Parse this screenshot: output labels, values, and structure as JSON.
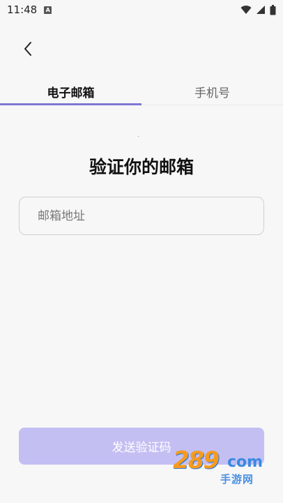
{
  "status_bar": {
    "time": "11:48",
    "notification_icon": "a-icon",
    "wifi_icon": "wifi-icon",
    "signal_icon": "signal-icon",
    "battery_icon": "battery-icon"
  },
  "header": {
    "back_icon": "chevron-left-icon"
  },
  "tabs": [
    {
      "label": "电子邮箱",
      "active": true
    },
    {
      "label": "手机号",
      "active": false
    }
  ],
  "main": {
    "title": "验证你的邮箱",
    "email_placeholder": "邮箱地址",
    "send_button_label": "发送验证码"
  },
  "watermark": {
    "brand": "289",
    "suffix": "com",
    "subtitle": "手游网"
  },
  "colors": {
    "accent": "#7e76d3",
    "button_disabled": "#c3bff3",
    "background": "#f7f7f8"
  }
}
